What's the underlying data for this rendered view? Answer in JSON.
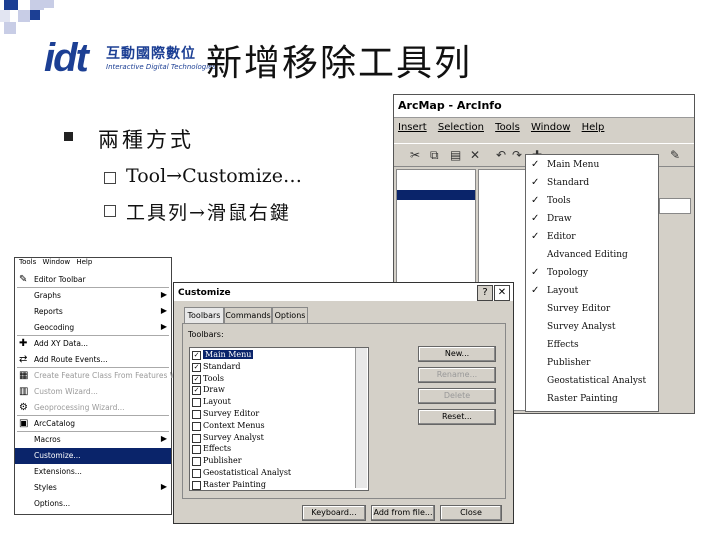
{
  "slide": {
    "title": "新增移除工具列",
    "logo": {
      "mark": "idt",
      "name_cn": "互動國際數位",
      "name_en": "Interactive Digital Technologies"
    },
    "bullet_main": "兩種方式",
    "sub_bullets": [
      "Tool→Customize…",
      "工具列→滑鼠右鍵"
    ],
    "colors": {
      "logo_blue": "#1c3f94",
      "square_blue": "#1c3f94",
      "square_light": "#c8cde6"
    }
  },
  "arcmap": {
    "title": "ArcMap - ArcInfo",
    "menu": [
      "Insert",
      "Selection",
      "Tools",
      "Window",
      "Help"
    ],
    "context_menu": [
      {
        "label": "Main Menu",
        "checked": true
      },
      {
        "label": "Standard",
        "checked": true
      },
      {
        "label": "Tools",
        "checked": true
      },
      {
        "label": "Draw",
        "checked": true
      },
      {
        "label": "Editor",
        "checked": true
      },
      {
        "label": "Advanced Editing",
        "checked": false
      },
      {
        "label": "Topology",
        "checked": true
      },
      {
        "label": "Layout",
        "checked": true
      },
      {
        "label": "Survey Editor",
        "checked": false
      },
      {
        "label": "Survey Analyst",
        "checked": false
      },
      {
        "label": "Effects",
        "checked": false
      },
      {
        "label": "Publisher",
        "checked": false
      },
      {
        "label": "Geostatistical Analyst",
        "checked": false
      },
      {
        "label": "Raster Painting",
        "checked": false
      }
    ]
  },
  "tools_menu": {
    "menubar": [
      "Tools",
      "Window",
      "Help"
    ],
    "items": [
      {
        "label": "Editor Toolbar",
        "icon": "editor-icon",
        "arrow": false,
        "disabled": false,
        "selected": false
      },
      {
        "label": "Graphs",
        "icon": "",
        "arrow": true,
        "disabled": false,
        "selected": false
      },
      {
        "label": "Reports",
        "icon": "",
        "arrow": true,
        "disabled": false,
        "selected": false
      },
      {
        "label": "Geocoding",
        "icon": "",
        "arrow": true,
        "disabled": false,
        "selected": false
      },
      {
        "label": "Add XY Data...",
        "icon": "xy-icon",
        "arrow": false,
        "disabled": false,
        "selected": false
      },
      {
        "label": "Add Route Events...",
        "icon": "route-icon",
        "arrow": false,
        "disabled": false,
        "selected": false
      },
      {
        "label": "Create Feature Class From Features Wizard",
        "icon": "wizard-icon",
        "arrow": false,
        "disabled": true,
        "selected": false
      },
      {
        "label": "Custom Wizard...",
        "icon": "custom-wizard-icon",
        "arrow": false,
        "disabled": true,
        "selected": false
      },
      {
        "label": "Geoprocessing Wizard...",
        "icon": "geoproc-icon",
        "arrow": false,
        "disabled": true,
        "selected": false
      },
      {
        "label": "ArcCatalog",
        "icon": "arccatalog-icon",
        "arrow": false,
        "disabled": false,
        "selected": false
      },
      {
        "label": "Macros",
        "icon": "",
        "arrow": true,
        "disabled": false,
        "selected": false
      },
      {
        "label": "Customize...",
        "icon": "",
        "arrow": false,
        "disabled": false,
        "selected": true
      },
      {
        "label": "Extensions...",
        "icon": "",
        "arrow": false,
        "disabled": false,
        "selected": false
      },
      {
        "label": "Styles",
        "icon": "",
        "arrow": true,
        "disabled": false,
        "selected": false
      },
      {
        "label": "Options...",
        "icon": "",
        "arrow": false,
        "disabled": false,
        "selected": false
      }
    ]
  },
  "customize": {
    "title": "Customize",
    "help_btn": "?",
    "close_btn": "✕",
    "tabs": [
      "Toolbars",
      "Commands",
      "Options"
    ],
    "toolbars_label": "Toolbars:",
    "list": [
      {
        "label": "Main Menu",
        "checked": true,
        "selected": true
      },
      {
        "label": "Standard",
        "checked": true,
        "selected": false
      },
      {
        "label": "Tools",
        "checked": true,
        "selected": false
      },
      {
        "label": "Draw",
        "checked": true,
        "selected": false
      },
      {
        "label": "Layout",
        "checked": false,
        "selected": false
      },
      {
        "label": "Survey Editor",
        "checked": false,
        "selected": false
      },
      {
        "label": "Context Menus",
        "checked": false,
        "selected": false
      },
      {
        "label": "Survey Analyst",
        "checked": false,
        "selected": false
      },
      {
        "label": "Effects",
        "checked": false,
        "selected": false
      },
      {
        "label": "Publisher",
        "checked": false,
        "selected": false
      },
      {
        "label": "Geostatistical Analyst",
        "checked": false,
        "selected": false
      },
      {
        "label": "Raster Painting",
        "checked": false,
        "selected": false
      }
    ],
    "buttons": {
      "new": "New...",
      "rename": "Rename...",
      "delete": "Delete",
      "reset": "Reset..."
    },
    "bottom_buttons": {
      "keyboard": "Keyboard...",
      "add_from_file": "Add from file...",
      "close": "Close"
    }
  }
}
